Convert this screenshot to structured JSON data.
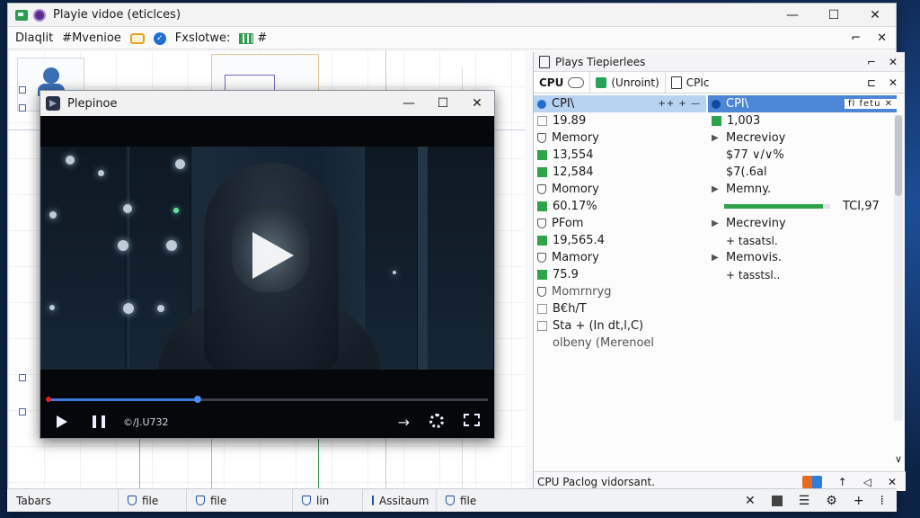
{
  "window": {
    "title": "Playie vidoe (eticlces)",
    "controls": {
      "minimize": "—",
      "maximize": "☐",
      "close": "✕"
    }
  },
  "menubar": {
    "item1": "Dlaqlit",
    "item2": "#Mvenioe",
    "item3": "Fxslotwe:",
    "item4": "#",
    "right_pin": "⌐",
    "right_close": "✕"
  },
  "player": {
    "title": "Plepinoe",
    "timecode": "©/J.U732",
    "progress_fraction": 0.34,
    "controls": {
      "minimize": "—",
      "maximize": "☐",
      "close": "✕",
      "forward": "→"
    }
  },
  "panel": {
    "header": "Plays Tiepierlees",
    "header_controls": {
      "pin": "⌐",
      "close": "✕"
    },
    "tabs": [
      "CPU",
      "(Unroint)",
      "CPIc"
    ],
    "tab_controls": {
      "dock": "⊏",
      "close": "✕"
    },
    "left": {
      "row1": "CPI\\",
      "row1_trail": "++ + —",
      "row2": "19.89",
      "row3": "Memory",
      "row4": "13,554",
      "row5": "12,584",
      "row6": "Momory",
      "row7": "60.17%",
      "row8": "PFom",
      "row9": "19,565.4",
      "row10": "Mamory",
      "row11": "75.9",
      "row12": "Momrnryg",
      "row13": "B€h/T",
      "row14": "Sta + (In dt,l,C)",
      "row15": "olbeny (Merenoel"
    },
    "right": {
      "row1": "CPI\\",
      "row1_trail": "fl fetu ✕",
      "row2": "1,003",
      "row3": "Mecrevioy",
      "row4": "$77 ∨/∨%",
      "row5": "$7(.6al",
      "row6": "Memny.",
      "progress_fraction": 0.93,
      "progress_value": "TCI,97",
      "row8": "Mecreviny",
      "row9": "+ tasatsl.",
      "row10": "Memovis.",
      "row11": "+ tasstsl.."
    },
    "footer": "CPU Paclog vidorsant.",
    "footer_controls": {
      "up": "↑",
      "send": "◁",
      "close": "✕"
    },
    "scroll_down": "∨"
  },
  "taskbar": {
    "items": [
      "Tabars",
      "file",
      "file",
      "lin",
      "Assitaum",
      "file"
    ],
    "tray": {
      "close": "✕",
      "menu": "☰",
      "settings": "⚙",
      "add": "+",
      "drag": "⁞"
    }
  }
}
